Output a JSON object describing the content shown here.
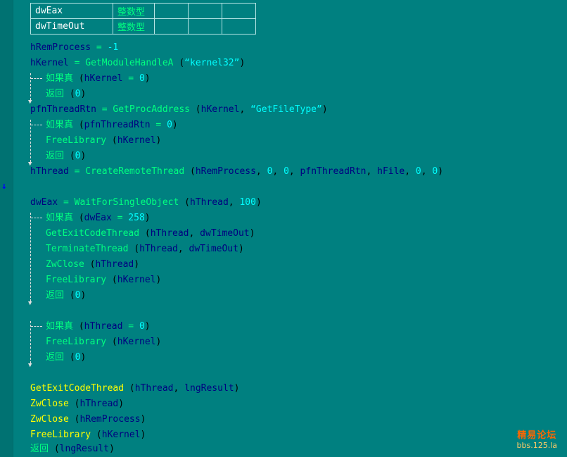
{
  "vartable": [
    {
      "name": "dwEax",
      "type": "整数型"
    },
    {
      "name": "dwTimeOut",
      "type": "整数型"
    }
  ],
  "code": {
    "l1_var": "hRemProcess",
    "l1_eq": " = ",
    "l1_num": "-1",
    "l2_var": "hKernel",
    "l2_eq": " = ",
    "l2_fn": "GetModuleHandleA",
    "l2_open": " (",
    "l2_str": "“kernel32”",
    "l2_close": ")",
    "l3_kw": "如果真",
    "l3_open": " (",
    "l3_var": "hKernel",
    "l3_eq": " = ",
    "l3_num": "0",
    "l3_close": ")",
    "l4_kw": "返回",
    "l4_open": " (",
    "l4_num": "0",
    "l4_close": ")",
    "l5_var": "pfnThreadRtn",
    "l5_eq": " = ",
    "l5_fn": "GetProcAddress",
    "l5_open": " (",
    "l5_arg": "hKernel",
    "l5_comma": ", ",
    "l5_str": "“GetFileType”",
    "l5_close": ")",
    "l6_kw": "如果真",
    "l6_open": " (",
    "l6_var": "pfnThreadRtn",
    "l6_eq": " = ",
    "l6_num": "0",
    "l6_close": ")",
    "l7_fn": "FreeLibrary",
    "l7_open": " (",
    "l7_arg": "hKernel",
    "l7_close": ")",
    "l8_kw": "返回",
    "l8_open": " (",
    "l8_num": "0",
    "l8_close": ")",
    "l9_var": "hThread",
    "l9_eq": " = ",
    "l9_fn": "CreateRemoteThread",
    "l9_open": " (",
    "l9_a1": "hRemProcess",
    "l9_c1": ", ",
    "l9_a2": "0",
    "l9_c2": ", ",
    "l9_a3": "0",
    "l9_c3": ", ",
    "l9_a4": "pfnThreadRtn",
    "l9_c4": ", ",
    "l9_a5": "hFile",
    "l9_c5": ", ",
    "l9_a6": "0",
    "l9_c6": ", ",
    "l9_a7": "0",
    "l9_close": ")",
    "l10_var": "dwEax",
    "l10_eq": " = ",
    "l10_fn": "WaitForSingleObject",
    "l10_open": " (",
    "l10_a1": "hThread",
    "l10_c1": ", ",
    "l10_a2": "100",
    "l10_close": ")",
    "l11_kw": "如果真",
    "l11_open": " (",
    "l11_var": "dwEax",
    "l11_eq": " = ",
    "l11_num": "258",
    "l11_close": ")",
    "l12_fn": "GetExitCodeThread",
    "l12_open": " (",
    "l12_a1": "hThread",
    "l12_c1": ", ",
    "l12_a2": "dwTimeOut",
    "l12_close": ")",
    "l13_fn": "TerminateThread",
    "l13_open": " (",
    "l13_a1": "hThread",
    "l13_c1": ", ",
    "l13_a2": "dwTimeOut",
    "l13_close": ")",
    "l14_fn": "ZwClose",
    "l14_open": " (",
    "l14_a1": "hThread",
    "l14_close": ")",
    "l15_fn": "FreeLibrary",
    "l15_open": " (",
    "l15_a1": "hKernel",
    "l15_close": ")",
    "l16_kw": "返回",
    "l16_open": " (",
    "l16_num": "0",
    "l16_close": ")",
    "l17_kw": "如果真",
    "l17_open": " (",
    "l17_var": "hThread",
    "l17_eq": " = ",
    "l17_num": "0",
    "l17_close": ")",
    "l18_fn": "FreeLibrary",
    "l18_open": " (",
    "l18_a1": "hKernel",
    "l18_close": ")",
    "l19_kw": "返回",
    "l19_open": " (",
    "l19_num": "0",
    "l19_close": ")",
    "l20_fn": "GetExitCodeThread",
    "l20_open": " (",
    "l20_a1": "hThread",
    "l20_c1": ", ",
    "l20_a2": "lngResult",
    "l20_close": ")",
    "l21_fn": "ZwClose",
    "l21_open": " (",
    "l21_a1": "hThread",
    "l21_close": ")",
    "l22_fn": "ZwClose",
    "l22_open": " (",
    "l22_a1": "hRemProcess",
    "l22_close": ")",
    "l23_fn": "FreeLibrary",
    "l23_open": " (",
    "l23_a1": "hKernel",
    "l23_close": ")",
    "l24_kw": "返回",
    "l24_open": " (",
    "l24_a1": "lngResult",
    "l24_close": ")"
  },
  "breakpoint_icon": "down-arrow-icon",
  "watermark": {
    "line1": "精易论坛",
    "line2": "bbs.125.la"
  }
}
